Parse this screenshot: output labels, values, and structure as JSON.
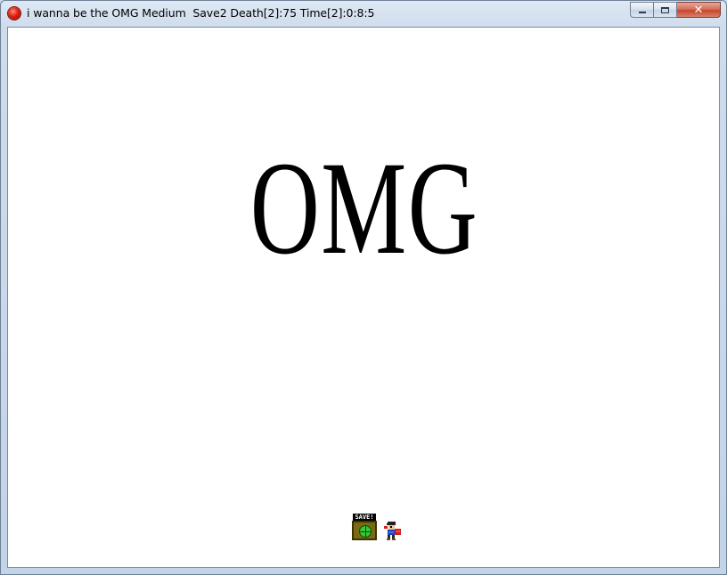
{
  "window": {
    "title": "i wanna be the OMG Medium  Save2 Death[2]:75 Time[2]:0:8:5",
    "controls": {
      "minimize": "minimize-icon",
      "maximize": "maximize-icon",
      "close": "close-icon"
    }
  },
  "game": {
    "logo_text": "OMG",
    "save_point_label": "SAVE!"
  },
  "colors": {
    "background": "#ffffff",
    "logo": "#000000",
    "save_box": "#7b6a10",
    "save_globe": "#37c737",
    "player_cape": "#d0201a"
  }
}
